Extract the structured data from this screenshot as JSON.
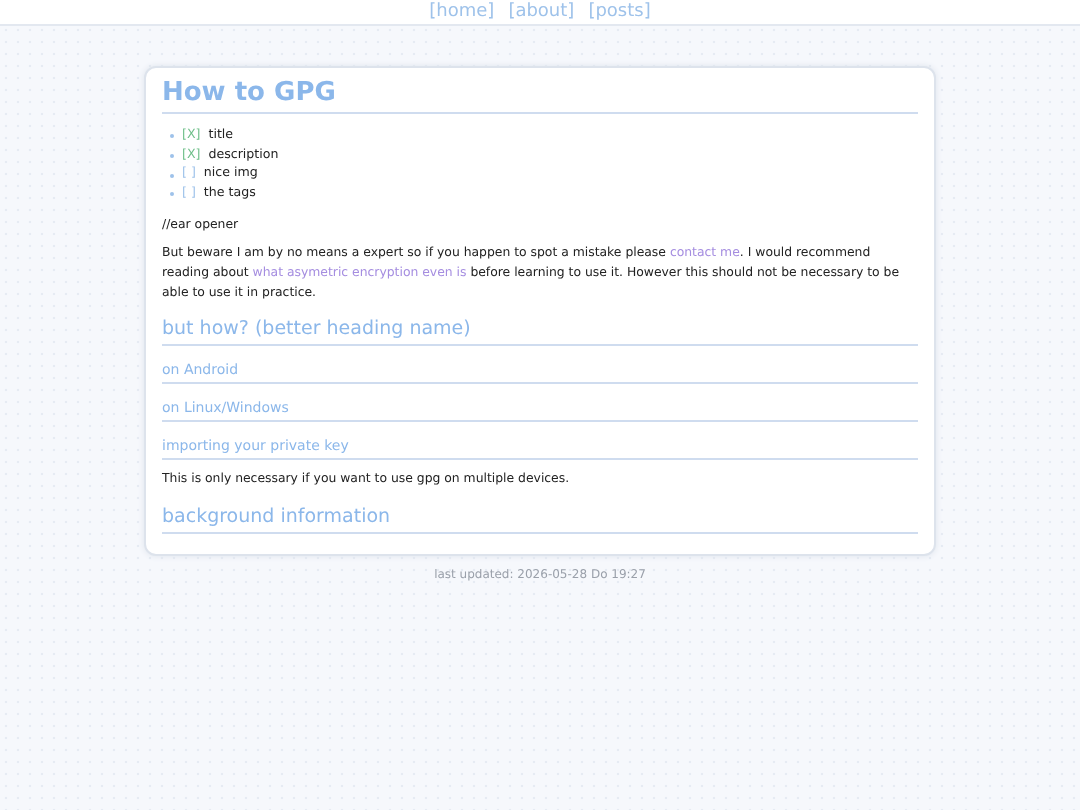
{
  "nav": [
    "[home]",
    "[about]",
    "[posts]"
  ],
  "title": "How to GPG",
  "todo": [
    {
      "mark": "[X]",
      "label": "title",
      "checked": true
    },
    {
      "mark": "[X]",
      "label": "description",
      "checked": true
    },
    {
      "mark": "[ ]",
      "label": "nice img",
      "checked": false
    },
    {
      "mark": "[ ]",
      "label": "the tags",
      "checked": false
    }
  ],
  "content": [
    {
      "kind": "paragraph",
      "parts": [
        {
          "kind": "text",
          "text": "//ear opener"
        }
      ]
    },
    {
      "kind": "paragraph",
      "parts": [
        {
          "kind": "text",
          "text": "But beware I am by no means a expert so if you happen to spot a mistake please "
        },
        {
          "kind": "link",
          "text": "contact me"
        },
        {
          "kind": "text",
          "text": ". I would recommend reading about "
        },
        {
          "kind": "link",
          "text": "what asymetric encryption even is"
        },
        {
          "kind": "text",
          "text": " before learning to use it. However this should not be necessary to be able to use it in practice."
        }
      ]
    },
    {
      "kind": "h2",
      "text": "but how? (better heading name)"
    },
    {
      "kind": "h3",
      "text": "on Android"
    },
    {
      "kind": "h3",
      "text": "on Linux/Windows"
    },
    {
      "kind": "h3",
      "text": "importing your private key"
    },
    {
      "kind": "paragraph",
      "parts": [
        {
          "kind": "text",
          "text": "This is only necessary if you want to use gpg on multiple devices."
        }
      ]
    },
    {
      "kind": "h2",
      "text": "background information"
    }
  ],
  "footer": "last updated: 2026-05-28 Do 19:27"
}
